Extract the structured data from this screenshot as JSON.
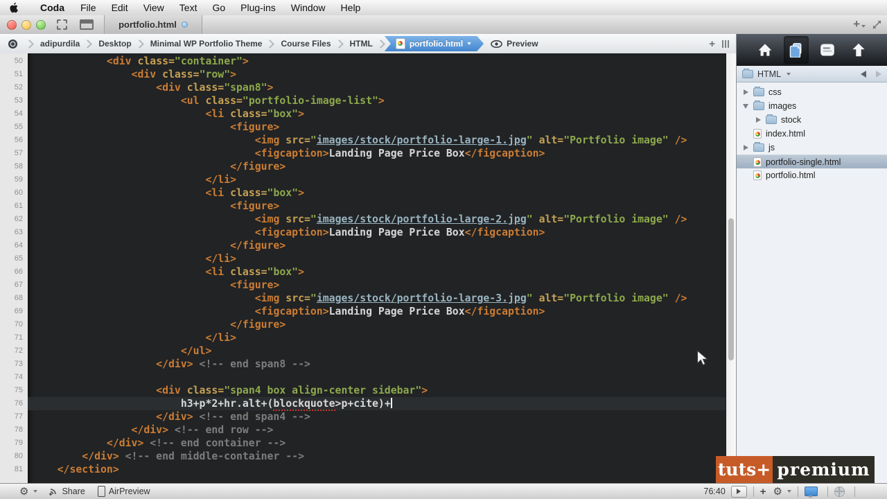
{
  "menu_bar": {
    "items": [
      "Coda",
      "File",
      "Edit",
      "View",
      "Text",
      "Go",
      "Plug-ins",
      "Window",
      "Help"
    ]
  },
  "window": {
    "tab_title": "portfolio.html"
  },
  "pathbar": {
    "items": [
      "adipurdila",
      "Desktop",
      "Minimal WP Portfolio Theme",
      "Course Files",
      "HTML"
    ],
    "active": "portfolio.html",
    "preview_label": "Preview"
  },
  "editor": {
    "current_line": 76,
    "lines": [
      {
        "n": 50,
        "i": 3,
        "tk": [
          [
            "tag",
            "<div"
          ],
          [
            "pl",
            " "
          ],
          [
            "at",
            "class="
          ],
          [
            "st",
            "\"container\""
          ],
          [
            "tag",
            ">"
          ]
        ]
      },
      {
        "n": 51,
        "i": 4,
        "tk": [
          [
            "tag",
            "<div"
          ],
          [
            "pl",
            " "
          ],
          [
            "at",
            "class="
          ],
          [
            "st",
            "\"row\""
          ],
          [
            "tag",
            ">"
          ]
        ]
      },
      {
        "n": 52,
        "i": 5,
        "tk": [
          [
            "tag",
            "<div"
          ],
          [
            "pl",
            " "
          ],
          [
            "at",
            "class="
          ],
          [
            "st",
            "\"span8\""
          ],
          [
            "tag",
            ">"
          ]
        ]
      },
      {
        "n": 53,
        "i": 6,
        "tk": [
          [
            "tag",
            "<ul"
          ],
          [
            "pl",
            " "
          ],
          [
            "at",
            "class="
          ],
          [
            "st",
            "\"portfolio-image-list\""
          ],
          [
            "tag",
            ">"
          ]
        ]
      },
      {
        "n": 54,
        "i": 7,
        "tk": [
          [
            "tag",
            "<li"
          ],
          [
            "pl",
            " "
          ],
          [
            "at",
            "class="
          ],
          [
            "st",
            "\"box\""
          ],
          [
            "tag",
            ">"
          ]
        ]
      },
      {
        "n": 55,
        "i": 8,
        "tk": [
          [
            "tag",
            "<figure>"
          ]
        ]
      },
      {
        "n": 56,
        "i": 9,
        "tk": [
          [
            "tag",
            "<img"
          ],
          [
            "pl",
            " "
          ],
          [
            "at",
            "src="
          ],
          [
            "st",
            "\""
          ],
          [
            "lk",
            "images/stock/portfolio-large-1.jpg"
          ],
          [
            "st",
            "\""
          ],
          [
            "pl",
            " "
          ],
          [
            "at",
            "alt="
          ],
          [
            "st",
            "\"Portfolio image\""
          ],
          [
            "pl",
            " "
          ],
          [
            "tag",
            "/>"
          ]
        ]
      },
      {
        "n": 57,
        "i": 9,
        "tk": [
          [
            "tag",
            "<figcaption>"
          ],
          [
            "pl",
            "Landing Page Price Box"
          ],
          [
            "tag",
            "</figcaption>"
          ]
        ]
      },
      {
        "n": 58,
        "i": 8,
        "tk": [
          [
            "tag",
            "</figure>"
          ]
        ]
      },
      {
        "n": 59,
        "i": 7,
        "tk": [
          [
            "tag",
            "</li>"
          ]
        ]
      },
      {
        "n": 60,
        "i": 7,
        "tk": [
          [
            "tag",
            "<li"
          ],
          [
            "pl",
            " "
          ],
          [
            "at",
            "class="
          ],
          [
            "st",
            "\"box\""
          ],
          [
            "tag",
            ">"
          ]
        ]
      },
      {
        "n": 61,
        "i": 8,
        "tk": [
          [
            "tag",
            "<figure>"
          ]
        ]
      },
      {
        "n": 62,
        "i": 9,
        "tk": [
          [
            "tag",
            "<img"
          ],
          [
            "pl",
            " "
          ],
          [
            "at",
            "src="
          ],
          [
            "st",
            "\""
          ],
          [
            "lk",
            "images/stock/portfolio-large-2.jpg"
          ],
          [
            "st",
            "\""
          ],
          [
            "pl",
            " "
          ],
          [
            "at",
            "alt="
          ],
          [
            "st",
            "\"Portfolio image\""
          ],
          [
            "pl",
            " "
          ],
          [
            "tag",
            "/>"
          ]
        ]
      },
      {
        "n": 63,
        "i": 9,
        "tk": [
          [
            "tag",
            "<figcaption>"
          ],
          [
            "pl",
            "Landing Page Price Box"
          ],
          [
            "tag",
            "</figcaption>"
          ]
        ]
      },
      {
        "n": 64,
        "i": 8,
        "tk": [
          [
            "tag",
            "</figure>"
          ]
        ]
      },
      {
        "n": 65,
        "i": 7,
        "tk": [
          [
            "tag",
            "</li>"
          ]
        ]
      },
      {
        "n": 66,
        "i": 7,
        "tk": [
          [
            "tag",
            "<li"
          ],
          [
            "pl",
            " "
          ],
          [
            "at",
            "class="
          ],
          [
            "st",
            "\"box\""
          ],
          [
            "tag",
            ">"
          ]
        ]
      },
      {
        "n": 67,
        "i": 8,
        "tk": [
          [
            "tag",
            "<figure>"
          ]
        ]
      },
      {
        "n": 68,
        "i": 9,
        "tk": [
          [
            "tag",
            "<img"
          ],
          [
            "pl",
            " "
          ],
          [
            "at",
            "src="
          ],
          [
            "st",
            "\""
          ],
          [
            "lk",
            "images/stock/portfolio-large-3.jpg"
          ],
          [
            "st",
            "\""
          ],
          [
            "pl",
            " "
          ],
          [
            "at",
            "alt="
          ],
          [
            "st",
            "\"Portfolio image\""
          ],
          [
            "pl",
            " "
          ],
          [
            "tag",
            "/>"
          ]
        ]
      },
      {
        "n": 69,
        "i": 9,
        "tk": [
          [
            "tag",
            "<figcaption>"
          ],
          [
            "pl",
            "Landing Page Price Box"
          ],
          [
            "tag",
            "</figcaption>"
          ]
        ]
      },
      {
        "n": 70,
        "i": 8,
        "tk": [
          [
            "tag",
            "</figure>"
          ]
        ]
      },
      {
        "n": 71,
        "i": 7,
        "tk": [
          [
            "tag",
            "</li>"
          ]
        ]
      },
      {
        "n": 72,
        "i": 6,
        "tk": [
          [
            "tag",
            "</ul>"
          ]
        ]
      },
      {
        "n": 73,
        "i": 5,
        "tk": [
          [
            "tag",
            "</div>"
          ],
          [
            "cm",
            " <!-- end span8 -->"
          ]
        ]
      },
      {
        "n": 74,
        "i": 0,
        "tk": []
      },
      {
        "n": 75,
        "i": 5,
        "tk": [
          [
            "tag",
            "<div"
          ],
          [
            "pl",
            " "
          ],
          [
            "at",
            "class="
          ],
          [
            "st",
            "\"span4 box align-center sidebar\""
          ],
          [
            "tag",
            ">"
          ]
        ]
      },
      {
        "n": 76,
        "i": 6,
        "caret": true,
        "tk": [
          [
            "pl",
            "h3+p*2+hr.alt+("
          ],
          [
            "ms",
            "blockquote"
          ],
          [
            "pl",
            ">p+cite)+"
          ]
        ]
      },
      {
        "n": 77,
        "i": 5,
        "tk": [
          [
            "tag",
            "</div>"
          ],
          [
            "cm",
            " <!-- end span4 -->"
          ]
        ]
      },
      {
        "n": 78,
        "i": 4,
        "tk": [
          [
            "tag",
            "</div>"
          ],
          [
            "cm",
            " <!-- end row -->"
          ]
        ]
      },
      {
        "n": 79,
        "i": 3,
        "tk": [
          [
            "tag",
            "</div>"
          ],
          [
            "cm",
            " <!-- end container -->"
          ]
        ]
      },
      {
        "n": 80,
        "i": 2,
        "tk": [
          [
            "tag",
            "</div>"
          ],
          [
            "cm",
            " <!-- end middle-container -->"
          ]
        ]
      },
      {
        "n": 81,
        "i": 1,
        "tk": [
          [
            "tag",
            "</section>"
          ]
        ]
      }
    ]
  },
  "sidebar": {
    "folder_label": "HTML",
    "tree": [
      {
        "label": "css",
        "icon": "folder",
        "disclosure": "right",
        "depth": 0,
        "selected": false
      },
      {
        "label": "images",
        "icon": "folder",
        "disclosure": "down",
        "depth": 0,
        "selected": false
      },
      {
        "label": "stock",
        "icon": "folder",
        "disclosure": "right",
        "depth": 1,
        "selected": false
      },
      {
        "label": "index.html",
        "icon": "html",
        "disclosure": "none",
        "depth": 0,
        "selected": false
      },
      {
        "label": "js",
        "icon": "folder",
        "disclosure": "right",
        "depth": 0,
        "selected": false
      },
      {
        "label": "portfolio-single.html",
        "icon": "html",
        "disclosure": "none",
        "depth": 0,
        "selected": true
      },
      {
        "label": "portfolio.html",
        "icon": "html",
        "disclosure": "none",
        "depth": 0,
        "selected": false
      }
    ]
  },
  "statusbar": {
    "share_label": "Share",
    "airpreview_label": "AirPreview",
    "position": "76:40",
    "gear_glyph": "⚙"
  },
  "logo": {
    "left": "tuts+",
    "right": "premium"
  },
  "colors": {
    "accent_blue": "#4486cf",
    "logo_orange": "#c75b28",
    "code_bg": "#212325",
    "tag": "#cb7d34",
    "attr": "#c7a253",
    "string": "#8ea94c",
    "link": "#9ab4c0",
    "comment": "#7d7d7d",
    "squiggle": "#c8372d"
  }
}
